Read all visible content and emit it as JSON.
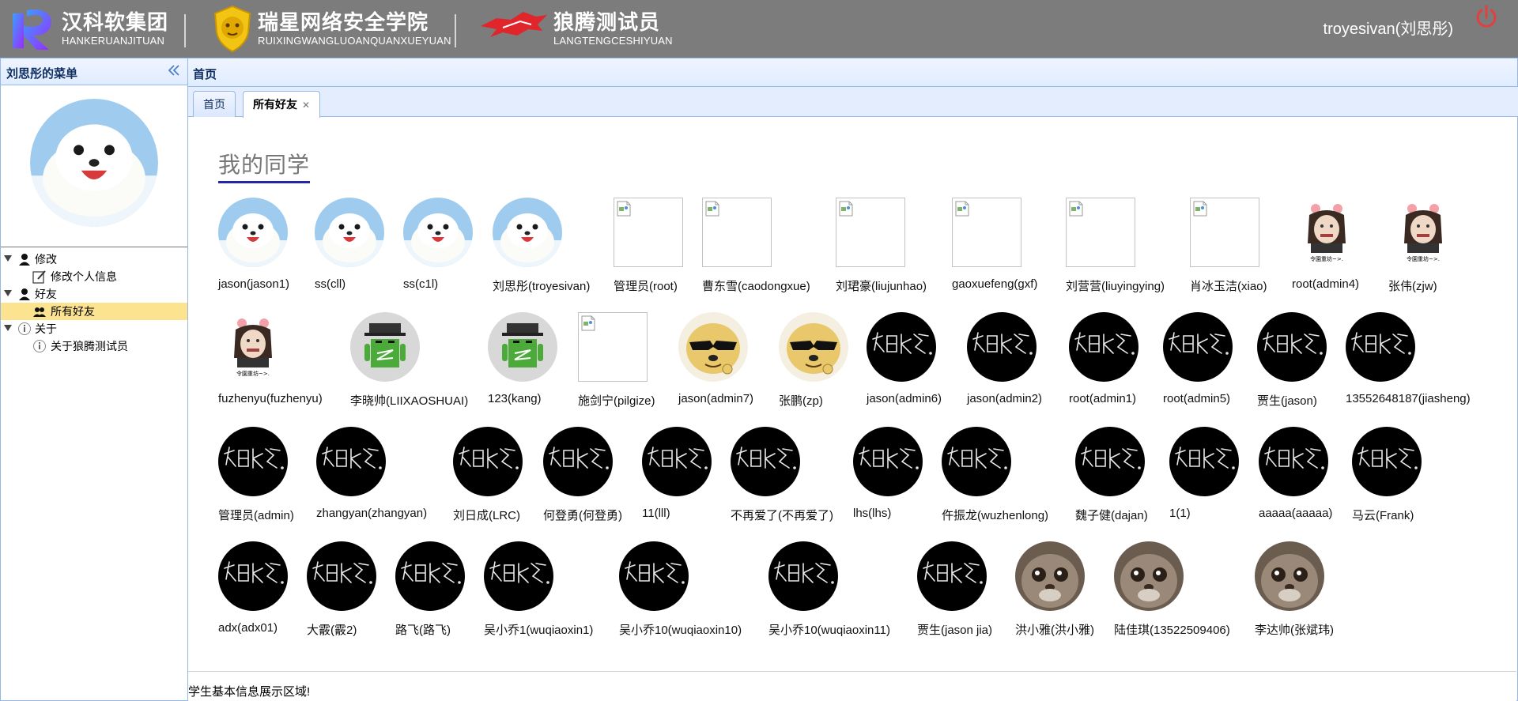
{
  "header": {
    "brands": [
      {
        "cn": "汉科软集团",
        "py": "HANKERUANJITUAN"
      },
      {
        "cn": "瑞星网络安全学院",
        "py": "RUIXINGWANGLUOANQUANXUEYUAN"
      },
      {
        "cn": "狼腾测试员",
        "py": "LANGTENGCESHIYUAN"
      }
    ],
    "user": "troyesivan(刘思彤)",
    "icons": {
      "power": "power-icon",
      "collapse": "double-chevron-left-icon"
    }
  },
  "sidebar": {
    "title": "刘思彤的菜单",
    "tree": [
      {
        "label": "修改",
        "level": 1,
        "icon": "user-icon"
      },
      {
        "label": "修改个人信息",
        "level": 2,
        "icon": "edit-icon"
      },
      {
        "label": "好友",
        "level": 1,
        "icon": "user-icon"
      },
      {
        "label": "所有好友",
        "level": 2,
        "icon": "group-icon",
        "selected": true
      },
      {
        "label": "关于",
        "level": 1,
        "icon": "info-icon"
      },
      {
        "label": "关于狼腾测试员",
        "level": 2,
        "icon": "info-icon"
      }
    ]
  },
  "main": {
    "title": "首页",
    "tabs": [
      {
        "label": "首页",
        "closable": false,
        "active": false
      },
      {
        "label": "所有好友",
        "closable": true,
        "active": true
      }
    ],
    "heading": "我的同学",
    "footer": "学生基本信息展示区域!"
  },
  "friends": [
    {
      "name": "jason(jason1)",
      "avatar": "seal"
    },
    {
      "name": "ss(cll)",
      "avatar": "seal"
    },
    {
      "name": "ss(c1l)",
      "avatar": "seal"
    },
    {
      "name": "刘思彤(troyesivan)",
      "avatar": "seal"
    },
    {
      "name": "管理员(root)",
      "avatar": "broken"
    },
    {
      "name": "曹东雪(caodongxue)",
      "avatar": "broken"
    },
    {
      "name": "刘珺豪(liujunhao)",
      "avatar": "broken"
    },
    {
      "name": "gaoxuefeng(gxf)",
      "avatar": "broken"
    },
    {
      "name": "刘营营(liuyingying)",
      "avatar": "broken"
    },
    {
      "name": "肖冰玉洁(xiao)",
      "avatar": "broken"
    },
    {
      "name": "root(admin4)",
      "avatar": "meme"
    },
    {
      "name": "张伟(zjw)",
      "avatar": "meme"
    },
    {
      "name": "fuzhenyu(fuzhenyu)",
      "avatar": "meme"
    },
    {
      "name": "李晓帅(LIIXAOSHUAI)",
      "avatar": "android"
    },
    {
      "name": "123(kang)",
      "avatar": "android"
    },
    {
      "name": "施剑宁(pilgize)",
      "avatar": "broken"
    },
    {
      "name": "jason(admin7)",
      "avatar": "doge"
    },
    {
      "name": "张鹏(zp)",
      "avatar": "doge"
    },
    {
      "name": "jason(admin6)",
      "avatar": "script"
    },
    {
      "name": "jason(admin2)",
      "avatar": "script"
    },
    {
      "name": "root(admin1)",
      "avatar": "script"
    },
    {
      "name": "root(admin5)",
      "avatar": "script"
    },
    {
      "name": "贾生(jason)",
      "avatar": "script"
    },
    {
      "name": "13552648187(jiasheng)",
      "avatar": "script"
    },
    {
      "name": "管理员(admin)",
      "avatar": "script"
    },
    {
      "name": "zhangyan(zhangyan)",
      "avatar": "script"
    },
    {
      "name": "刘日成(LRC)",
      "avatar": "script"
    },
    {
      "name": "何登勇(何登勇)",
      "avatar": "script"
    },
    {
      "name": "11(lll)",
      "avatar": "script"
    },
    {
      "name": "不再爱了(不再爱了)",
      "avatar": "script"
    },
    {
      "name": "lhs(lhs)",
      "avatar": "script"
    },
    {
      "name": "仵振龙(wuzhenlong)",
      "avatar": "script"
    },
    {
      "name": "魏子健(dajan)",
      "avatar": "script"
    },
    {
      "name": "1(1)",
      "avatar": "script"
    },
    {
      "name": "aaaaa(aaaaa)",
      "avatar": "script"
    },
    {
      "name": "马云(Frank)",
      "avatar": "script"
    },
    {
      "name": "adx(adx01)",
      "avatar": "script"
    },
    {
      "name": "大霰(霰2)",
      "avatar": "script"
    },
    {
      "name": "路飞(路飞)",
      "avatar": "script"
    },
    {
      "name": "吴小乔1(wuqiaoxin1)",
      "avatar": "script"
    },
    {
      "name": "吴小乔10(wuqiaoxin10)",
      "avatar": "script"
    },
    {
      "name": "吴小乔10(wuqiaoxin11)",
      "avatar": "script"
    },
    {
      "name": "贾生(jason jia)",
      "avatar": "script"
    },
    {
      "name": "洪小雅(洪小雅)",
      "avatar": "cat"
    },
    {
      "name": "陆佳琪(13522509406)",
      "avatar": "cat"
    },
    {
      "name": "李达帅(张斌玮)",
      "avatar": "cat"
    }
  ],
  "colors": {
    "header": "#7c7c7c",
    "panel_border": "#95b8e7",
    "panel_head": "#e0ecff",
    "selected": "#fbe38f",
    "heading_underline": "#2525a8",
    "power": "#e04040"
  }
}
